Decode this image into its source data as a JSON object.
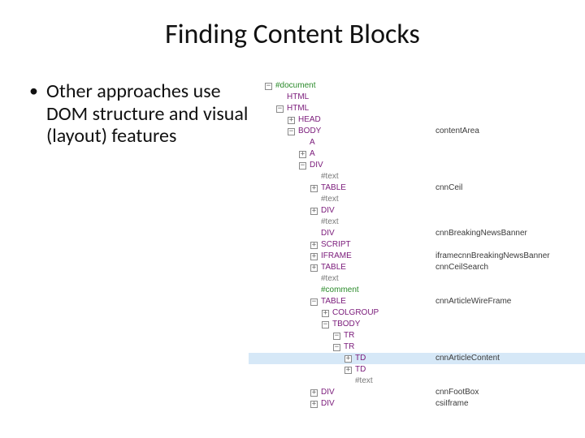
{
  "title": "Finding Content Blocks",
  "bullet": "Other approaches use DOM structure and visual (layout) features",
  "tree": [
    {
      "indent": 0,
      "toggle": "-",
      "label": "#document",
      "cls": "node-doc",
      "annot": ""
    },
    {
      "indent": 14,
      "toggle": "",
      "label": "HTML",
      "cls": "node-label",
      "annot": ""
    },
    {
      "indent": 14,
      "toggle": "-",
      "label": "HTML",
      "cls": "node-label",
      "annot": ""
    },
    {
      "indent": 28,
      "toggle": "+",
      "label": "HEAD",
      "cls": "node-label",
      "annot": ""
    },
    {
      "indent": 28,
      "toggle": "-",
      "label": "BODY",
      "cls": "node-label",
      "annot": "contentArea"
    },
    {
      "indent": 42,
      "toggle": "",
      "label": "A",
      "cls": "node-label",
      "annot": ""
    },
    {
      "indent": 42,
      "toggle": "+",
      "label": "A",
      "cls": "node-label",
      "annot": ""
    },
    {
      "indent": 42,
      "toggle": "-",
      "label": "DIV",
      "cls": "node-label",
      "annot": ""
    },
    {
      "indent": 56,
      "toggle": "",
      "label": "#text",
      "cls": "node-text-gray",
      "annot": ""
    },
    {
      "indent": 56,
      "toggle": "+",
      "label": "TABLE",
      "cls": "node-label",
      "annot": "cnnCeil"
    },
    {
      "indent": 56,
      "toggle": "",
      "label": "#text",
      "cls": "node-text-gray",
      "annot": ""
    },
    {
      "indent": 56,
      "toggle": "+",
      "label": "DIV",
      "cls": "node-label",
      "annot": ""
    },
    {
      "indent": 56,
      "toggle": "",
      "label": "#text",
      "cls": "node-text-gray",
      "annot": ""
    },
    {
      "indent": 56,
      "toggle": "",
      "label": "DIV",
      "cls": "node-label",
      "annot": "cnnBreakingNewsBanner"
    },
    {
      "indent": 56,
      "toggle": "+",
      "label": "SCRIPT",
      "cls": "node-label",
      "annot": ""
    },
    {
      "indent": 56,
      "toggle": "+",
      "label": "IFRAME",
      "cls": "node-label",
      "annot": "iframecnnBreakingNewsBanner"
    },
    {
      "indent": 56,
      "toggle": "+",
      "label": "TABLE",
      "cls": "node-label",
      "annot": "cnnCeilSearch"
    },
    {
      "indent": 56,
      "toggle": "",
      "label": "#text",
      "cls": "node-text-gray",
      "annot": ""
    },
    {
      "indent": 56,
      "toggle": "",
      "label": "#comment",
      "cls": "node-comment",
      "annot": ""
    },
    {
      "indent": 56,
      "toggle": "-",
      "label": "TABLE",
      "cls": "node-label",
      "annot": "cnnArticleWireFrame"
    },
    {
      "indent": 70,
      "toggle": "+",
      "label": "COLGROUP",
      "cls": "node-label",
      "annot": ""
    },
    {
      "indent": 70,
      "toggle": "-",
      "label": "TBODY",
      "cls": "node-label",
      "annot": ""
    },
    {
      "indent": 84,
      "toggle": "-",
      "label": "TR",
      "cls": "node-label",
      "annot": ""
    },
    {
      "indent": 84,
      "toggle": "-",
      "label": "TR",
      "cls": "node-label",
      "annot": ""
    },
    {
      "indent": 98,
      "toggle": "+",
      "label": "TD",
      "cls": "node-label",
      "annot": "cnnArticleContent",
      "hl": true
    },
    {
      "indent": 98,
      "toggle": "+",
      "label": "TD",
      "cls": "node-label",
      "annot": ""
    },
    {
      "indent": 98,
      "toggle": "",
      "label": "#text",
      "cls": "node-text-gray",
      "annot": ""
    },
    {
      "indent": 56,
      "toggle": "+",
      "label": "DIV",
      "cls": "node-label",
      "annot": "cnnFootBox"
    },
    {
      "indent": 56,
      "toggle": "+",
      "label": "DIV",
      "cls": "node-label",
      "annot": "csiIframe"
    }
  ]
}
